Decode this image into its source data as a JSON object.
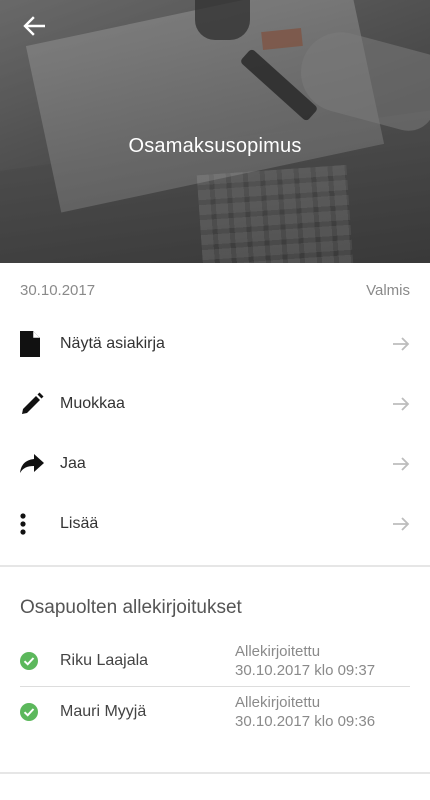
{
  "header": {
    "title": "Osamaksusopimus",
    "back_icon": "arrow-left-icon"
  },
  "document": {
    "date": "30.10.2017",
    "status": "Valmis"
  },
  "actions": [
    {
      "label": "Näytä asiakirja",
      "icon": "document-icon"
    },
    {
      "label": "Muokkaa",
      "icon": "pencil-icon"
    },
    {
      "label": "Jaa",
      "icon": "share-icon"
    },
    {
      "label": "Lisää",
      "icon": "more-vertical-icon"
    }
  ],
  "signatures": {
    "title": "Osapuolten allekirjoitukset",
    "items": [
      {
        "name": "Riku Laajala",
        "status": "Allekirjoitettu",
        "time": "30.10.2017 klo 09:37"
      },
      {
        "name": "Mauri Myyjä",
        "status": "Allekirjoitettu",
        "time": "30.10.2017 klo 09:36"
      }
    ]
  },
  "colors": {
    "check_green": "#5cb85c",
    "muted_text": "#8a8a8a",
    "arrow_gray": "#bdbdbd"
  }
}
